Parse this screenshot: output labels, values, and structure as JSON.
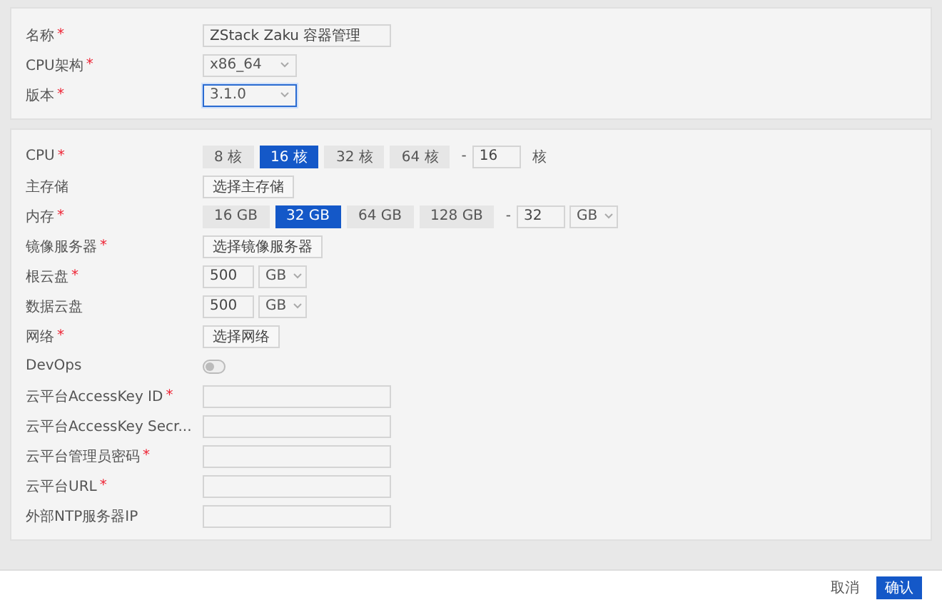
{
  "sections": [
    {
      "rows": [
        {
          "kind": "text",
          "label": "名称",
          "mark": "*",
          "value": "ZStack Zaku 容器管理"
        },
        {
          "kind": "select",
          "label": "CPU架构",
          "mark": "*",
          "value": "x86_64",
          "focused": false
        },
        {
          "kind": "select",
          "label": "版本",
          "mark": "*",
          "value": "3.1.0",
          "focused": true
        }
      ]
    },
    {
      "rows": [
        {
          "kind": "segmented",
          "label": "CPU",
          "mark": "*",
          "options": [
            {
              "label": "8 核",
              "selected": false
            },
            {
              "label": "16 核",
              "selected": true
            },
            {
              "label": "32 核",
              "selected": false
            },
            {
              "label": "64 核",
              "selected": false
            }
          ],
          "dash": "-",
          "value": "16",
          "suffix": "核"
        },
        {
          "kind": "button",
          "label": "主存储",
          "button": "选择主存储"
        },
        {
          "kind": "segmented",
          "label": "内存",
          "mark": "*",
          "options": [
            {
              "label": "16 GB",
              "selected": false
            },
            {
              "label": "32 GB",
              "selected": true
            },
            {
              "label": "64 GB",
              "selected": false
            },
            {
              "label": "128 GB",
              "selected": false
            }
          ],
          "dash": "-",
          "value": "32",
          "unit": "GB"
        },
        {
          "kind": "button",
          "label": "镜像服务器",
          "mark": "*",
          "button": "选择镜像服务器"
        },
        {
          "kind": "size",
          "label": "根云盘",
          "mark": "*",
          "value": "500",
          "unit": "GB"
        },
        {
          "kind": "size",
          "label": "数据云盘",
          "value": "500",
          "unit": "GB"
        },
        {
          "kind": "button",
          "label": "网络",
          "mark": "*",
          "button": "选择网络"
        },
        {
          "kind": "toggle",
          "label": "DevOps",
          "on": false
        },
        {
          "kind": "text",
          "label": "云平台AccessKey ID",
          "mark": "*"
        },
        {
          "kind": "text",
          "label": "云平台AccessKey Secr..."
        },
        {
          "kind": "text",
          "label": "云平台管理员密码",
          "mark": "*"
        },
        {
          "kind": "text",
          "label": "云平台URL",
          "mark": "*"
        },
        {
          "kind": "text",
          "label": "外部NTP服务器IP"
        }
      ]
    }
  ],
  "footer": {
    "buttons": [
      {
        "label": "取消",
        "kind": "plain"
      },
      {
        "label": "确认",
        "kind": "primary"
      }
    ]
  }
}
